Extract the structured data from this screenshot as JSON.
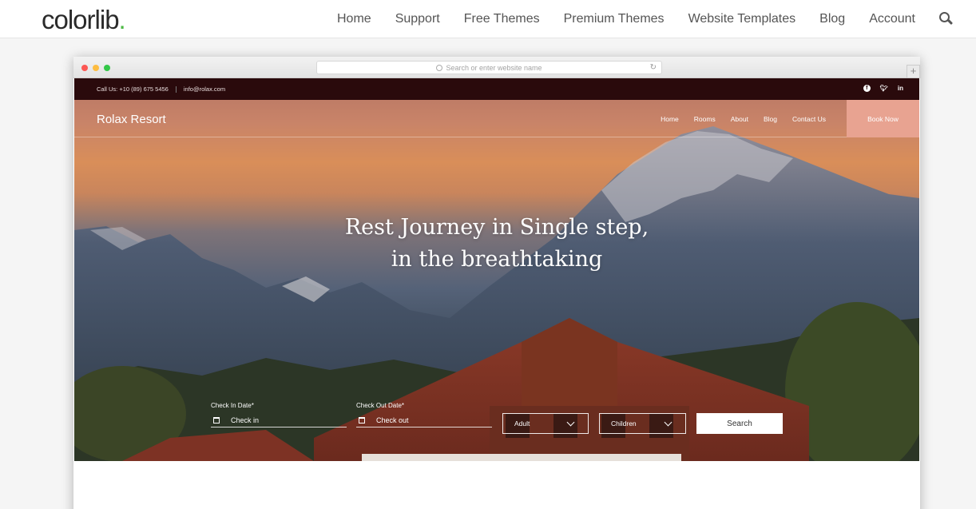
{
  "colorlib": {
    "logo": "colorlib",
    "logo_dot": ".",
    "nav": [
      "Home",
      "Support",
      "Free Themes",
      "Premium Themes",
      "Website Templates",
      "Blog",
      "Account"
    ],
    "accent_color": "#4cb944"
  },
  "browser": {
    "address_placeholder": "Search or enter website name",
    "new_tab": "+"
  },
  "site": {
    "topbar": {
      "phone": "Call Us: +10 (89) 675 5456",
      "email": "info@rolax.com",
      "social": [
        "facebook-icon",
        "twitter-icon",
        "linkedin-icon"
      ]
    },
    "brand": "Rolax Resort",
    "menu": [
      "Home",
      "Rooms",
      "About",
      "Blog",
      "Contact Us"
    ],
    "book_now": "Book Now",
    "headline_line1": "Rest Journey in Single step,",
    "headline_line2": "in the breathtaking",
    "booking": {
      "check_in_label": "Check In Date*",
      "check_in_placeholder": "Check in",
      "check_out_label": "Check Out Date*",
      "check_out_placeholder": "Check out",
      "adult": "Adult",
      "children": "Children",
      "search": "Search"
    },
    "topbar_color": "#2a0a0c",
    "book_color": "#e8a391"
  }
}
